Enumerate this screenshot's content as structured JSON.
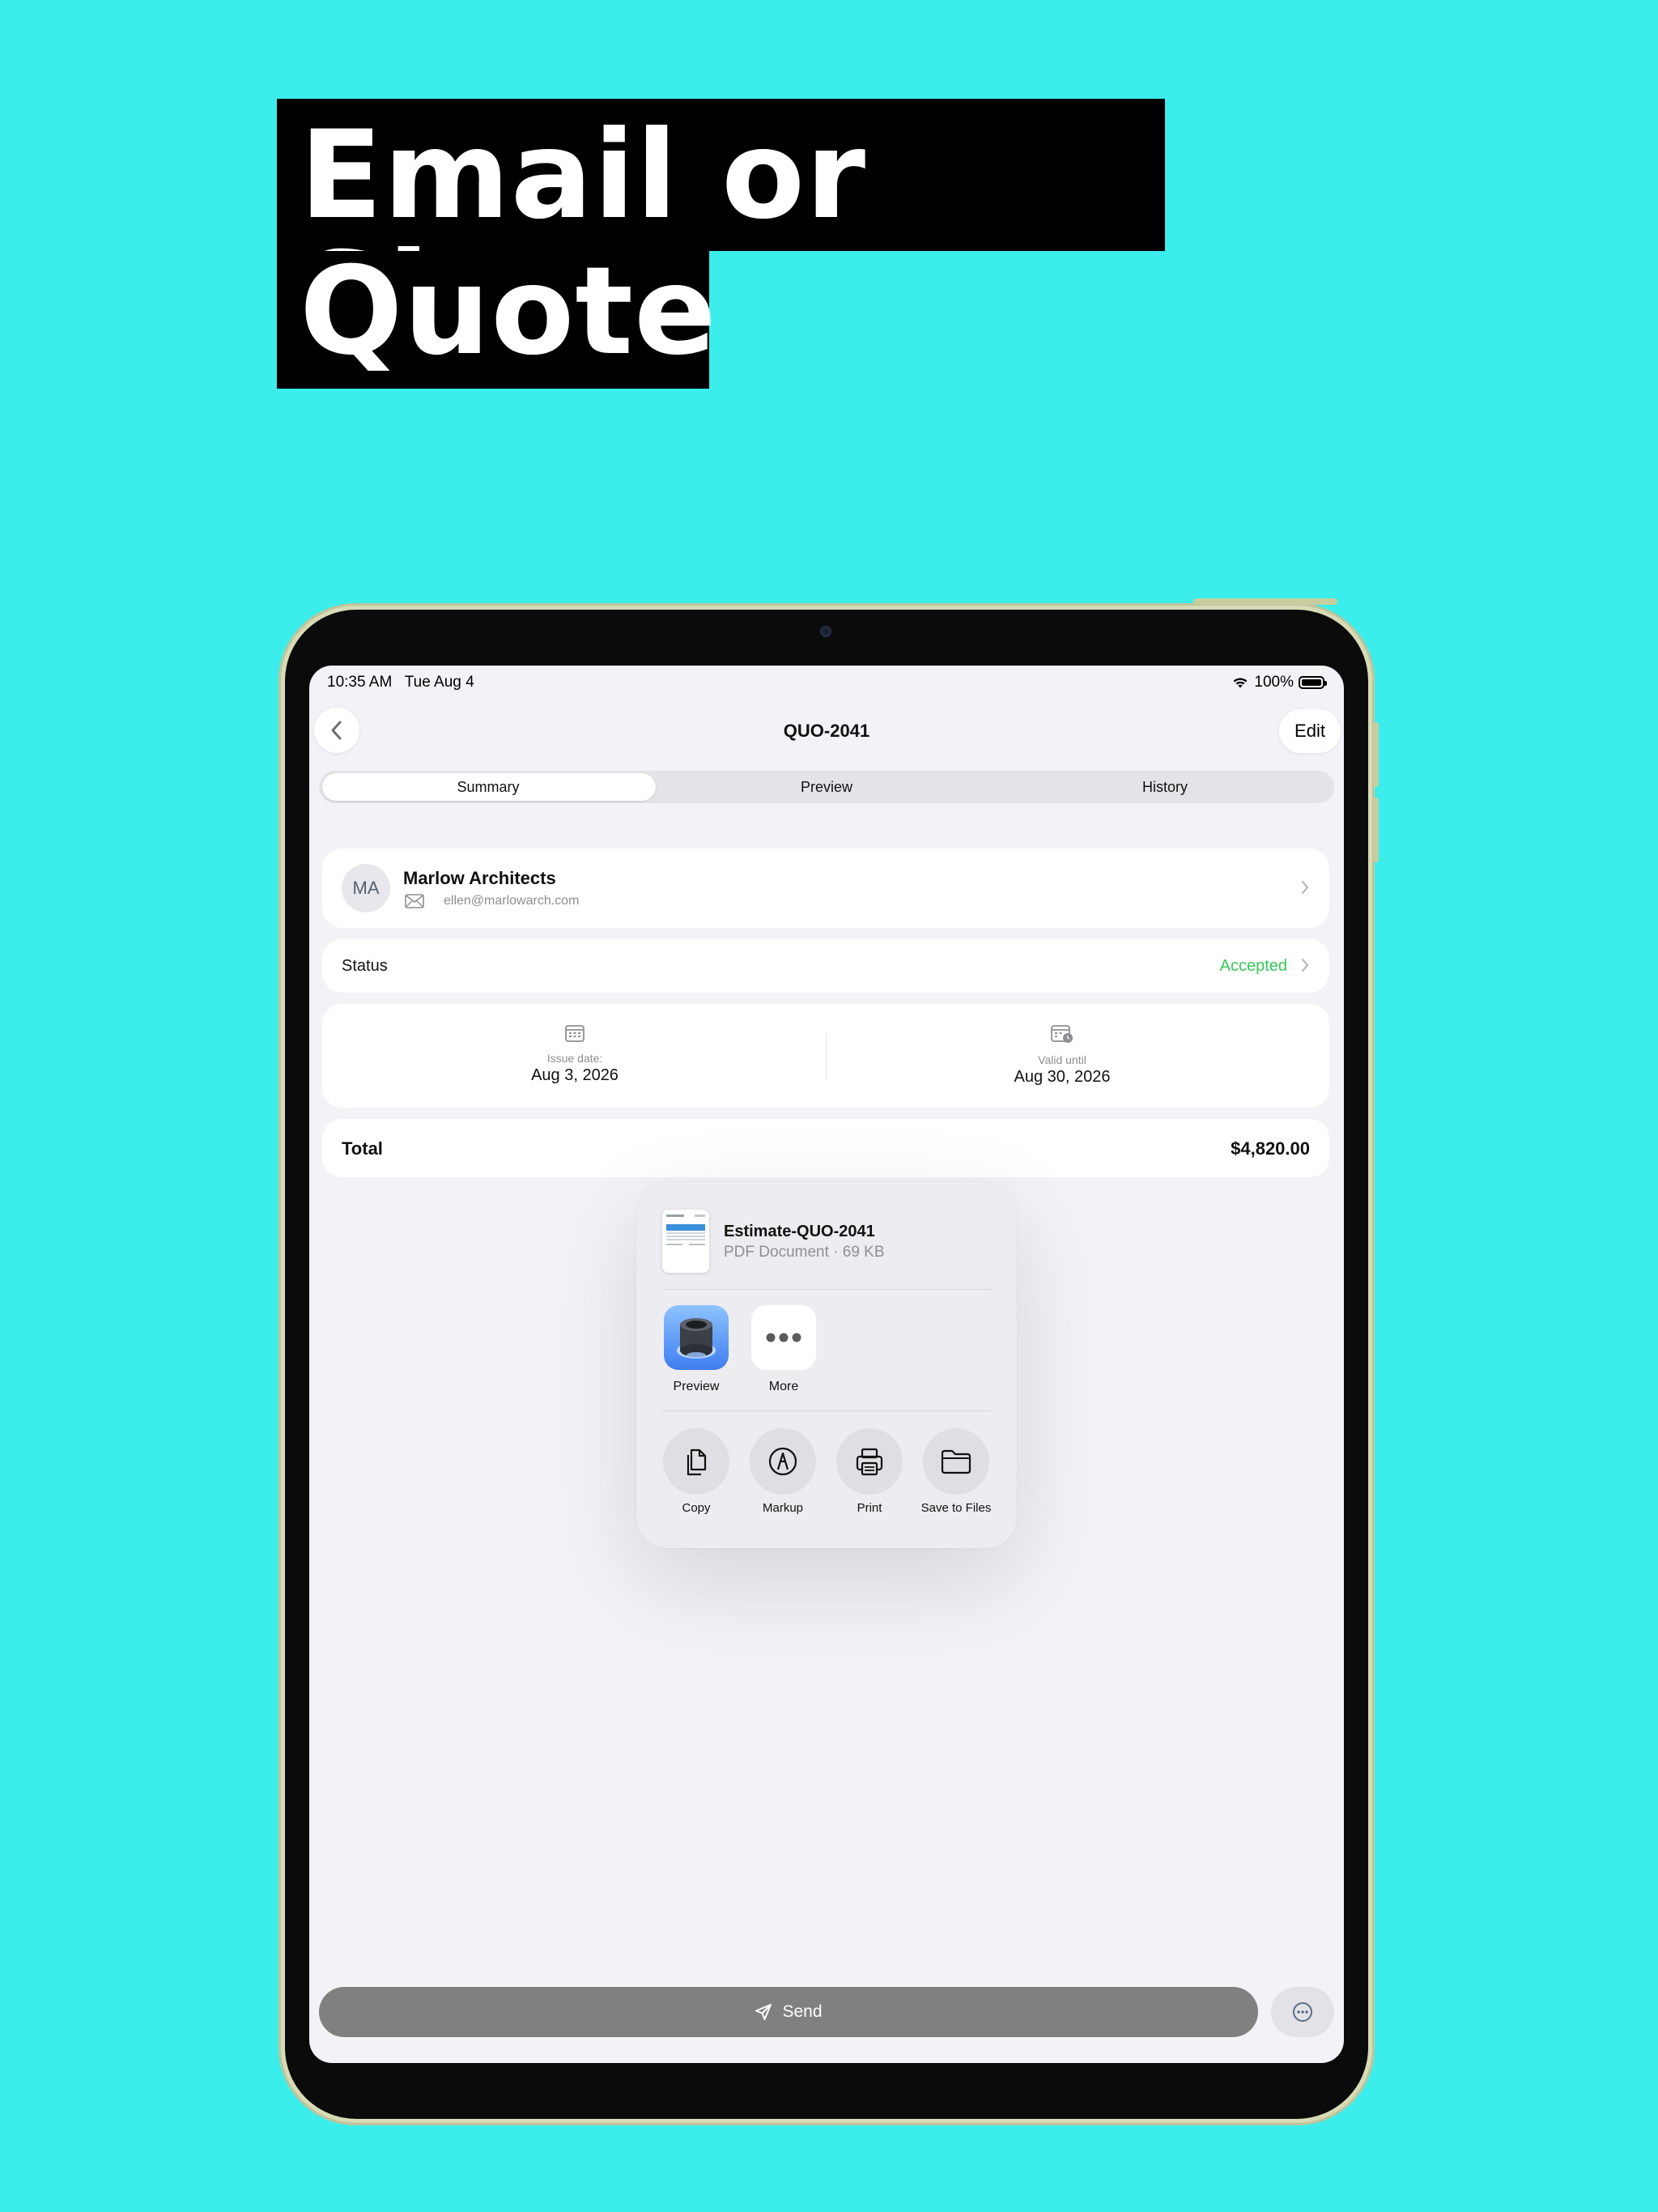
{
  "headline": {
    "line1": "Email or Share",
    "line2": "Quote"
  },
  "status_bar": {
    "time": "10:35 AM",
    "date": "Tue Aug 4",
    "battery": "100%"
  },
  "nav": {
    "title": "QUO-2041",
    "edit_label": "Edit"
  },
  "tabs": [
    {
      "label": "Summary",
      "selected": true
    },
    {
      "label": "Preview",
      "selected": false
    },
    {
      "label": "History",
      "selected": false
    }
  ],
  "client": {
    "initials": "MA",
    "name": "Marlow Architects",
    "email": "ellen@marlowarch.com"
  },
  "status": {
    "label": "Status",
    "value": "Accepted",
    "value_color": "#34c759"
  },
  "dates": {
    "issue": {
      "label": "Issue date:",
      "value": "Aug 3, 2026"
    },
    "valid": {
      "label": "Valid until",
      "value": "Aug 30, 2026"
    }
  },
  "total": {
    "label": "Total",
    "value": "$4,820.00"
  },
  "share_sheet": {
    "file_name": "Estimate-QUO-2041",
    "file_info": "PDF Document · 69 KB",
    "apps": [
      {
        "label": "Preview",
        "icon": "preview-app-icon"
      },
      {
        "label": "More",
        "icon": "more-dots-icon"
      }
    ],
    "actions": [
      {
        "label": "Copy",
        "icon": "copy-icon"
      },
      {
        "label": "Markup",
        "icon": "markup-icon"
      },
      {
        "label": "Print",
        "icon": "print-icon"
      },
      {
        "label": "Save to Files",
        "icon": "folder-icon"
      }
    ]
  },
  "bottom_bar": {
    "send_label": "Send"
  },
  "colors": {
    "background": "#3beeec",
    "accent_green": "#34c759",
    "send_button": "#808080"
  }
}
